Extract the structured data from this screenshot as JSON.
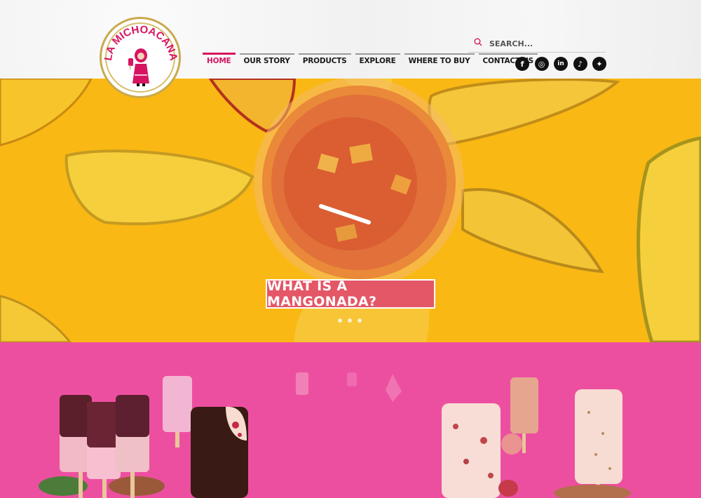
{
  "logo": {
    "brand": "LA MICHOACANA"
  },
  "nav": {
    "items": [
      {
        "label": "HOME",
        "active": true
      },
      {
        "label": "OUR STORY",
        "active": false
      },
      {
        "label": "PRODUCTS",
        "active": false
      },
      {
        "label": "EXPLORE",
        "active": false
      },
      {
        "label": "WHERE TO BUY",
        "active": false
      },
      {
        "label": "CONTACT US",
        "active": false
      }
    ],
    "accent_color": "#d6145f"
  },
  "search": {
    "placeholder": "SEARCH..."
  },
  "social": {
    "items": [
      {
        "name": "facebook-icon",
        "glyph": "f"
      },
      {
        "name": "instagram-icon",
        "glyph": "◎"
      },
      {
        "name": "linkedin-icon",
        "glyph": "in"
      },
      {
        "name": "tiktok-icon",
        "glyph": "♪"
      },
      {
        "name": "twitter-icon",
        "glyph": "✦"
      }
    ]
  },
  "hero": {
    "cta_label": "WHAT IS A MANGONADA?",
    "background_color": "#f9b814",
    "cta_color": "#e35766",
    "slide_count": 3
  },
  "products_section": {
    "background_color": "#ed4fa0"
  }
}
